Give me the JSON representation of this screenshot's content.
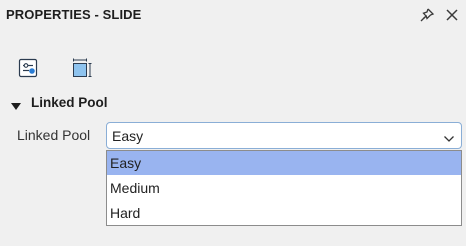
{
  "panel": {
    "title": "PROPERTIES - SLIDE",
    "actions": [
      {
        "icon": "pin-icon"
      },
      {
        "icon": "close-icon"
      }
    ]
  },
  "tabs": [
    {
      "icon": "slide-settings-icon",
      "active": true
    },
    {
      "icon": "slide-size-icon",
      "active": false
    }
  ],
  "section": {
    "title": "Linked Pool",
    "expanded": true
  },
  "field": {
    "label": "Linked Pool",
    "selected": "Easy",
    "options": [
      "Easy",
      "Medium",
      "Hard"
    ],
    "highlighted_option": "Easy"
  },
  "colors": {
    "accent": "#2b7cd3",
    "highlight": "#99b4f0",
    "select_border": "#8aaed6"
  }
}
